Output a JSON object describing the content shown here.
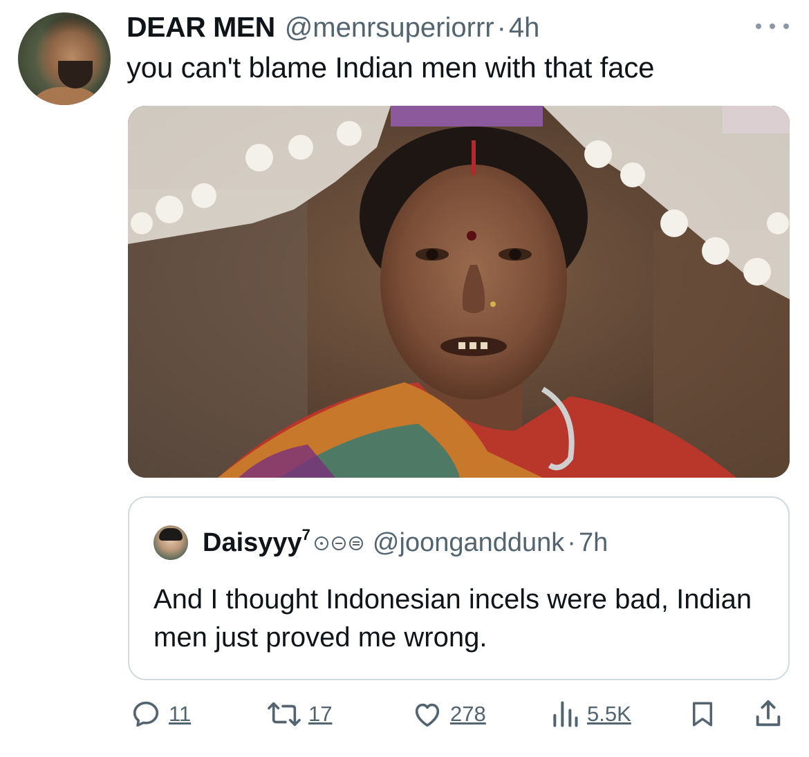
{
  "tweet": {
    "display_name": "DEAR MEN",
    "handle": "@menrsuperiorrr",
    "separator": "·",
    "time": "4h",
    "text": "you can't blame Indian men with that face",
    "more_icon": "more-horizontal-icon"
  },
  "quote": {
    "display_name": "Daisyyy",
    "superscript": "7",
    "handle": "@joonganddunk",
    "separator": "·",
    "time": "7h",
    "text": "And I thought Indonesian incels were bad, Indian men just proved me wrong."
  },
  "actions": {
    "reply": {
      "icon": "reply-icon",
      "count": "11"
    },
    "repost": {
      "icon": "repost-icon",
      "count": "17"
    },
    "like": {
      "icon": "heart-icon",
      "count": "278"
    },
    "views": {
      "icon": "views-icon",
      "count": "5.5K"
    },
    "bookmark": {
      "icon": "bookmark-icon"
    },
    "share": {
      "icon": "share-icon"
    }
  },
  "colors": {
    "text_primary": "#0f1419",
    "text_secondary": "#536471",
    "border": "#cfd9de"
  }
}
